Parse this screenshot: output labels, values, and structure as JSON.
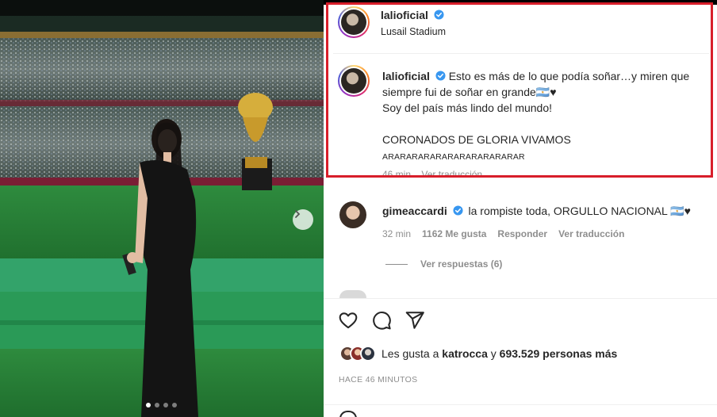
{
  "post": {
    "author": "lalioficial",
    "location": "Lusail Stadium"
  },
  "caption": {
    "author": "lalioficial",
    "line1": "Esto es más de lo que podía soñar…y miren que siempre fui de soñar en grande🇦🇷♥",
    "line2": "Soy del país más lindo del mundo!",
    "line3": "CORONADOS DE GLORIA VIVAMOS",
    "line4": "ARARARARARARARARARARARAR",
    "time": "46 min",
    "translate": "Ver traducción"
  },
  "comment": {
    "author": "gimeaccardi",
    "text": "la rompiste toda, ORGULLO NACIONAL 🇦🇷♥",
    "time": "32 min",
    "likes": "1162 Me gusta",
    "reply": "Responder",
    "translate": "Ver traducción",
    "replies": "Ver respuestas (6)"
  },
  "likes_text": {
    "prefix": "Les gusta a ",
    "user": "katrocca",
    "middle": " y ",
    "count": "693.529 personas más"
  },
  "timestamp": "HACE 46 MINUTOS",
  "icons": [
    "heart-icon",
    "comment-icon",
    "share-icon",
    "verified-badge-icon",
    "chevron-right-icon"
  ],
  "colors": {
    "verified": "#3897f0",
    "highlight_border": "#d81e2a",
    "muted": "#8e8e8e"
  },
  "carousel": {
    "slides": 4,
    "active": 1
  }
}
